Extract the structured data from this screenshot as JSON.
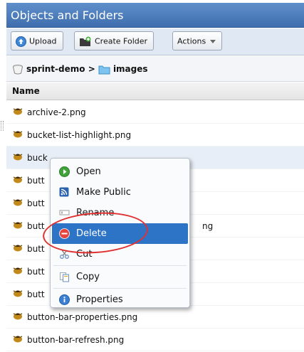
{
  "panel": {
    "title": "Objects and Folders"
  },
  "toolbar": {
    "upload_label": "Upload",
    "create_folder_label": "Create Folder",
    "actions_label": "Actions"
  },
  "breadcrumb": {
    "bucket": "sprint-demo",
    "separator": ">",
    "folder": "images"
  },
  "table": {
    "column_name": "Name",
    "rows": [
      "archive-2.png",
      "bucket-list-highlight.png",
      "buck",
      "butt",
      "butt",
      "butt",
      "butt",
      "butt",
      "butt",
      "button-bar-properties.png",
      "button-bar-refresh.png"
    ],
    "row_suffix_4": "ng"
  },
  "context_menu": {
    "items": [
      {
        "label": "Open",
        "icon": "open-arrow-icon"
      },
      {
        "label": "Make Public",
        "icon": "rss-icon"
      },
      {
        "label": "Rename",
        "icon": "rename-icon"
      },
      {
        "label": "Delete",
        "icon": "delete-icon"
      },
      {
        "label": "Cut",
        "icon": "scissors-icon"
      },
      {
        "label": "Copy",
        "icon": "copy-icon"
      },
      {
        "label": "Properties",
        "icon": "info-icon"
      }
    ]
  },
  "colors": {
    "title_bar": "#4a7bbd",
    "menu_highlight": "#2e74c6",
    "annotation": "#e03030"
  }
}
